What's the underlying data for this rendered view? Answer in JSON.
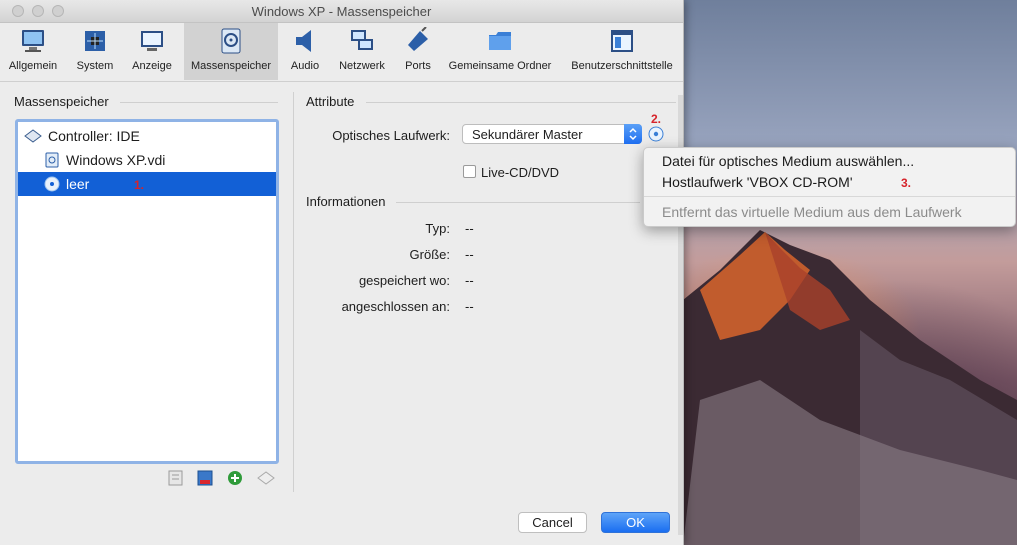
{
  "window": {
    "title": "Windows XP - Massenspeicher"
  },
  "toolbar": {
    "items": [
      {
        "label": "Allgemein",
        "icon": "monitor-icon"
      },
      {
        "label": "System",
        "icon": "chip-icon"
      },
      {
        "label": "Anzeige",
        "icon": "display-icon"
      },
      {
        "label": "Massenspeicher",
        "icon": "disk-icon",
        "selected": true
      },
      {
        "label": "Audio",
        "icon": "speaker-icon"
      },
      {
        "label": "Netzwerk",
        "icon": "network-icon"
      },
      {
        "label": "Ports",
        "icon": "plug-icon"
      },
      {
        "label": "Gemeinsame Ordner",
        "icon": "folder-icon"
      },
      {
        "label": "Benutzerschnittstelle",
        "icon": "window-ui-icon"
      }
    ]
  },
  "storage": {
    "heading": "Massenspeicher",
    "tree": [
      {
        "label": "Controller: IDE",
        "icon": "controller-icon"
      },
      {
        "label": "Windows XP.vdi",
        "icon": "hard-disk-icon"
      },
      {
        "label": "leer",
        "icon": "optical-disc-icon",
        "selected": true
      }
    ]
  },
  "attributes": {
    "heading": "Attribute",
    "drive_label": "Optisches Laufwerk:",
    "drive_value": "Sekundärer Master",
    "live_cd_label": "Live-CD/DVD"
  },
  "information": {
    "heading": "Informationen",
    "rows": [
      {
        "label": "Typ:",
        "value": "--"
      },
      {
        "label": "Größe:",
        "value": "--"
      },
      {
        "label": "gespeichert wo:",
        "value": "--"
      },
      {
        "label": "angeschlossen an:",
        "value": "--"
      }
    ]
  },
  "popup_menu": {
    "items": [
      "Datei für optisches Medium auswählen...",
      "Hostlaufwerk 'VBOX CD-ROM'",
      "Entfernt das virtuelle Medium aus dem Laufwerk"
    ]
  },
  "annotations": [
    "1.",
    "2.",
    "3."
  ],
  "buttons": {
    "cancel": "Cancel",
    "ok": "OK"
  },
  "colors": {
    "accent": "#1260d6",
    "annotation": "#d6232a"
  }
}
